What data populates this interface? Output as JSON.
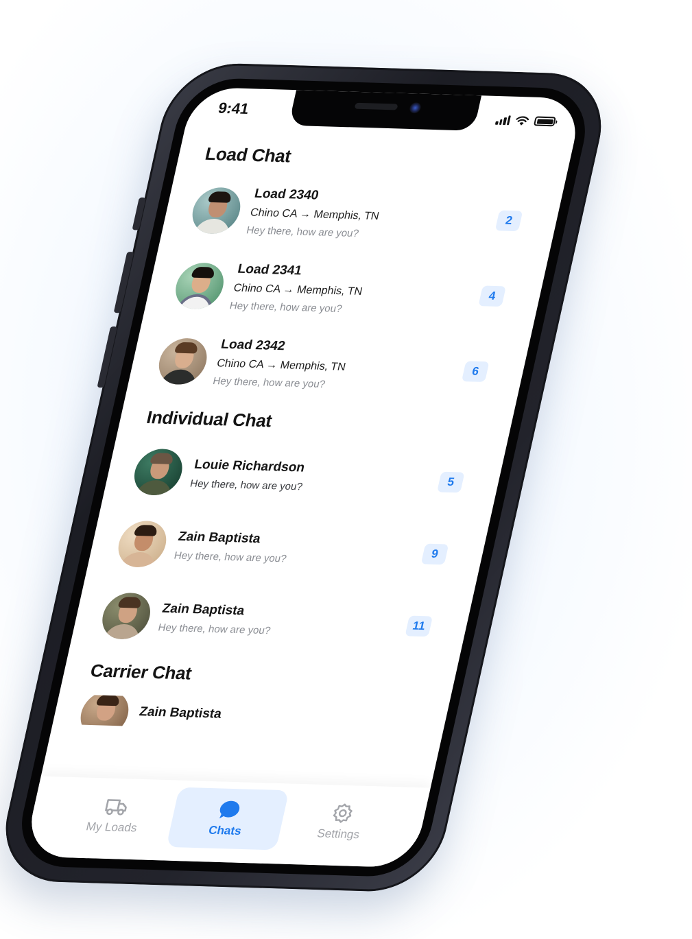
{
  "status_bar": {
    "time": "9:41",
    "icons": [
      "signal-icon",
      "wifi-icon",
      "battery-icon"
    ]
  },
  "sections": {
    "load_chat": {
      "title": "Load Chat",
      "items": [
        {
          "name": "Load 2340",
          "route": "Chino CA → Memphis, TN",
          "preview": "Hey there, how are you?",
          "unread": "2"
        },
        {
          "name": "Load 2341",
          "route": "Chino CA → Memphis, TN",
          "preview": "Hey there, how are you?",
          "unread": "4"
        },
        {
          "name": "Load 2342",
          "route": "Chino CA → Memphis, TN",
          "preview": "Hey there, how are you?",
          "unread": "6"
        }
      ]
    },
    "individual_chat": {
      "title": "Individual Chat",
      "items": [
        {
          "name": "Louie Richardson",
          "preview": "Hey there, how are you?",
          "unread": "5"
        },
        {
          "name": "Zain Baptista",
          "preview": "Hey there, how are you?",
          "unread": "9"
        },
        {
          "name": "Zain Baptista",
          "preview": "Hey there, how are you?",
          "unread": "11"
        }
      ]
    },
    "carrier_chat": {
      "title": "Carrier Chat",
      "items": [
        {
          "name": "Zain Baptista"
        }
      ]
    }
  },
  "tab_bar": {
    "tabs": [
      {
        "label": "My Loads",
        "icon": "truck-icon",
        "active": false
      },
      {
        "label": "Chats",
        "icon": "chat-bubble-icon",
        "active": true
      },
      {
        "label": "Settings",
        "icon": "gear-icon",
        "active": false
      }
    ]
  },
  "colors": {
    "accent": "#1f7aed",
    "badge_bg": "#e4efff",
    "muted_text": "#8a8d93",
    "inactive_tab": "#a3a5aa"
  }
}
